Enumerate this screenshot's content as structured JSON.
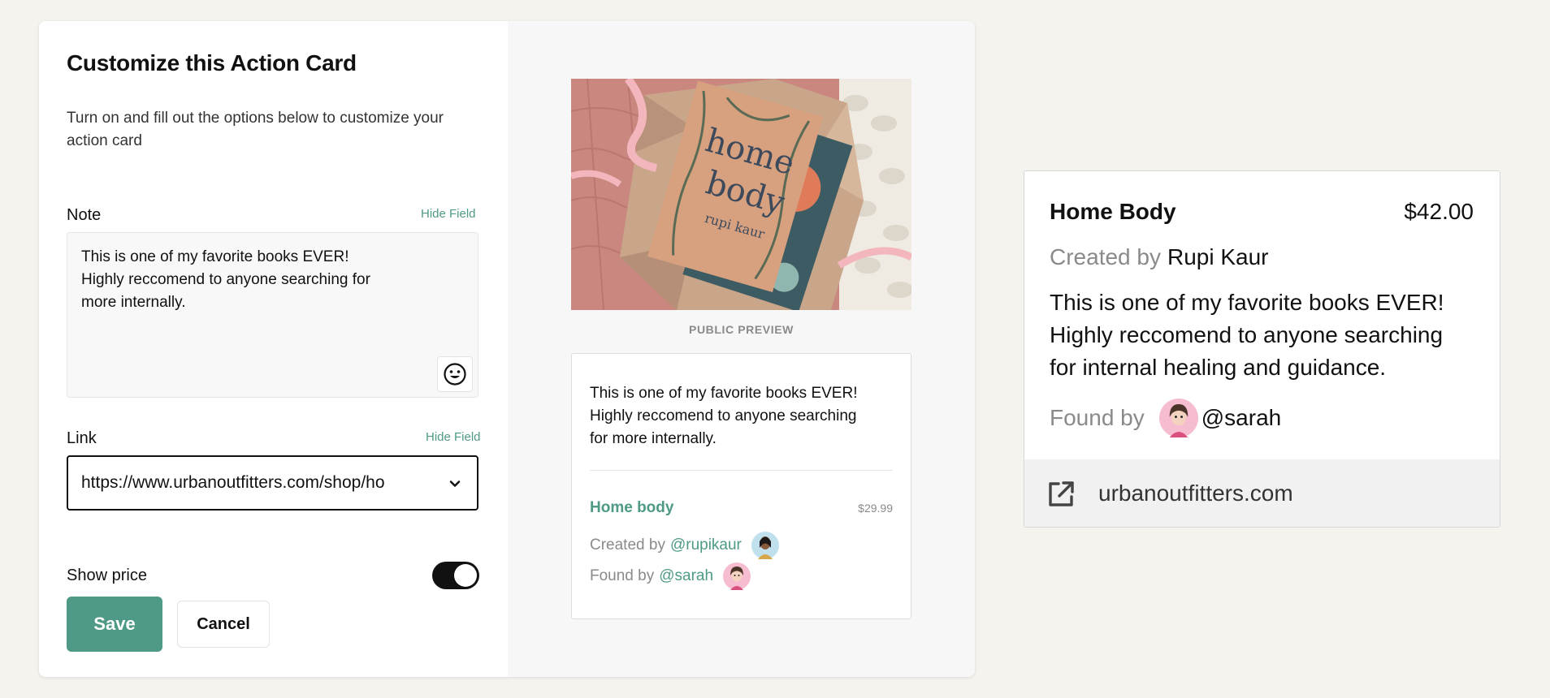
{
  "editor": {
    "title": "Customize this Action Card",
    "subtitle": "Turn on and fill out the options below to customize your action card",
    "note": {
      "label": "Note",
      "hide_label": "Hide Field",
      "value": "This is one of my favorite books EVER!\nHighly reccomend to anyone searching for\nmore internally."
    },
    "link": {
      "label": "Link",
      "hide_label": "Hide Field",
      "value": "https://www.urbanoutfitters.com/shop/ho"
    },
    "show_price": {
      "label": "Show price",
      "enabled": true
    },
    "save_label": "Save",
    "cancel_label": "Cancel"
  },
  "preview": {
    "caption": "PUBLIC PREVIEW",
    "note": "This is one of my favorite books EVER!\nHighly reccomend to anyone searching\nfor more internally.",
    "product_name": "Home body",
    "price": "$29.99",
    "created_prefix": "Created by",
    "creator_handle": "@rupikaur",
    "found_prefix": "Found by",
    "finder_handle": "@sarah",
    "book_cover_title_1": "home",
    "book_cover_title_2": "body",
    "book_cover_author": "rupi kaur"
  },
  "card": {
    "title": "Home Body",
    "price": "$42.00",
    "created_prefix": "Created by",
    "creator_name": "Rupi Kaur",
    "note": "This is one of my favorite books EVER! Highly reccomend to anyone searching for internal healing and guidance.",
    "found_prefix": "Found by",
    "finder_handle": "@sarah",
    "domain": "urbanoutfitters.com"
  },
  "colors": {
    "accent": "#4e9a86",
    "toggle_on": "#111111",
    "page_bg": "#f4f3ee"
  },
  "icons": {
    "emoji": "smiley-icon",
    "link_dropdown": "chevron-down-icon",
    "external": "external-link-icon"
  }
}
